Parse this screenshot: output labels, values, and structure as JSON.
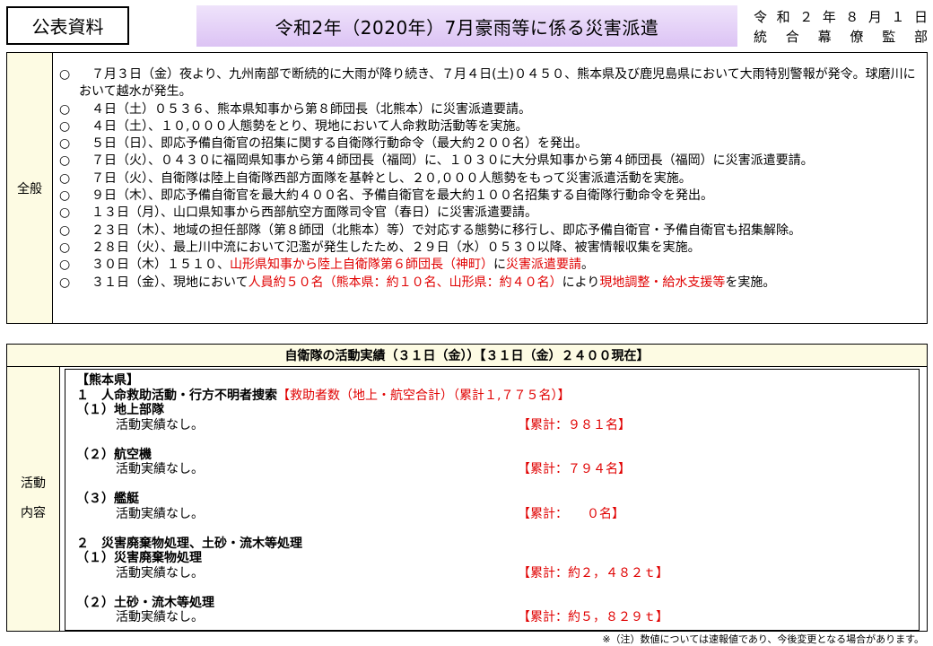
{
  "header": {
    "public_label": "公表資料",
    "title": "令和2年（2020年）7月豪雨等に係る災害派遣",
    "date": "令 和 ２ 年 ８ 月 １ 日",
    "issuer": "統 合 幕 僚 監 部"
  },
  "overview": {
    "side_label": "全般",
    "bullet": "○",
    "items": [
      {
        "text": "　７月３日（金）夜より、九州南部で断続的に大雨が降り続き、７月４日(土)０４５０、熊本県及び鹿児島県において大雨特別警報が発令。球磨川において越水が発生。"
      },
      {
        "text": "　４日（土）０５３６、熊本県知事から第８師団長（北熊本）に災害派遣要請。"
      },
      {
        "text": "　４日（土）、１０,０００人態勢をとり、現地において人命救助活動等を実施。"
      },
      {
        "text": "　５日（日）、即応予備自衛官の招集に関する自衛隊行動命令（最大約２００名）を発出。"
      },
      {
        "text": "　７日（火）、０４３０に福岡県知事から第４師団長（福岡）に、１０３０に大分県知事から第４師団長（福岡）に災害派遣要請。"
      },
      {
        "text": "　７日（火）、自衛隊は陸上自衛隊西部方面隊を基幹とし、２０,０００人態勢をもって災害派遣活動を実施。"
      },
      {
        "text": "　９日（木）、即応予備自衛官を最大約４００名、予備自衛官を最大約１００名招集する自衛隊行動命令を発出。"
      },
      {
        "text": "　１３日（月）、山口県知事から西部航空方面隊司令官（春日）に災害派遣要請。"
      },
      {
        "text": "　２３日（木）、地域の担任部隊（第８師団（北熊本）等）で対応する態勢に移行し、即応予備自衛官・予備自衛官も招集解除。"
      },
      {
        "text": "　２８日（火）、最上川中流において氾濫が発生したため、２９日（水）０５３０以降、被害情報収集を実施。"
      }
    ],
    "item11": {
      "pre": "　３０日（木）１５１０、",
      "red1": "山形県知事から陸上自衛隊第６師団長（神町）",
      "mid": "に",
      "red2": "災害派遣要請",
      "post": "。"
    },
    "item12": {
      "pre": "　３１日（金）、現地において",
      "red1": "人員約５０名（熊本県：約１０名、山形県：約４０名）",
      "mid": "により",
      "red2": "現地調整・給水支援等",
      "post": "を実施。"
    }
  },
  "activities": {
    "header": "自衛隊の活動実績（３１日（金））【３１日（金）２４００現在】",
    "side_label_1": "活動",
    "side_label_2": "内容",
    "prefecture": "【熊本県】",
    "sec1_title": "１　人命救助活動・行方不明者捜索",
    "sec1_total": "【救助者数（地上・航空合計）（累計１,７７５名）】",
    "ground_title": "（１）地上部隊",
    "ground_text": "活動実績なし。",
    "ground_cum": "【累計：９８１名】",
    "air_title": "（２）航空機",
    "air_text": "活動実績なし。",
    "air_cum": "【累計：７９４名】",
    "ship_title": "（３）艦艇",
    "ship_text": "活動実績なし。",
    "ship_cum": "【累計：　　０名】",
    "sec2_title": "２　災害廃棄物処理、土砂・流木等処理",
    "waste_title": "（１）災害廃棄物処理",
    "waste_text": "活動実績なし。",
    "waste_cum": "【累計：約２，４８２ｔ】",
    "soil_title": "（２）土砂・流木等処理",
    "soil_text": "活動実績なし。",
    "soil_cum": "【累計：約５，８２９ｔ】"
  },
  "footnote": "※（注）数値については速報値であり、今後変更となる場合があります。"
}
